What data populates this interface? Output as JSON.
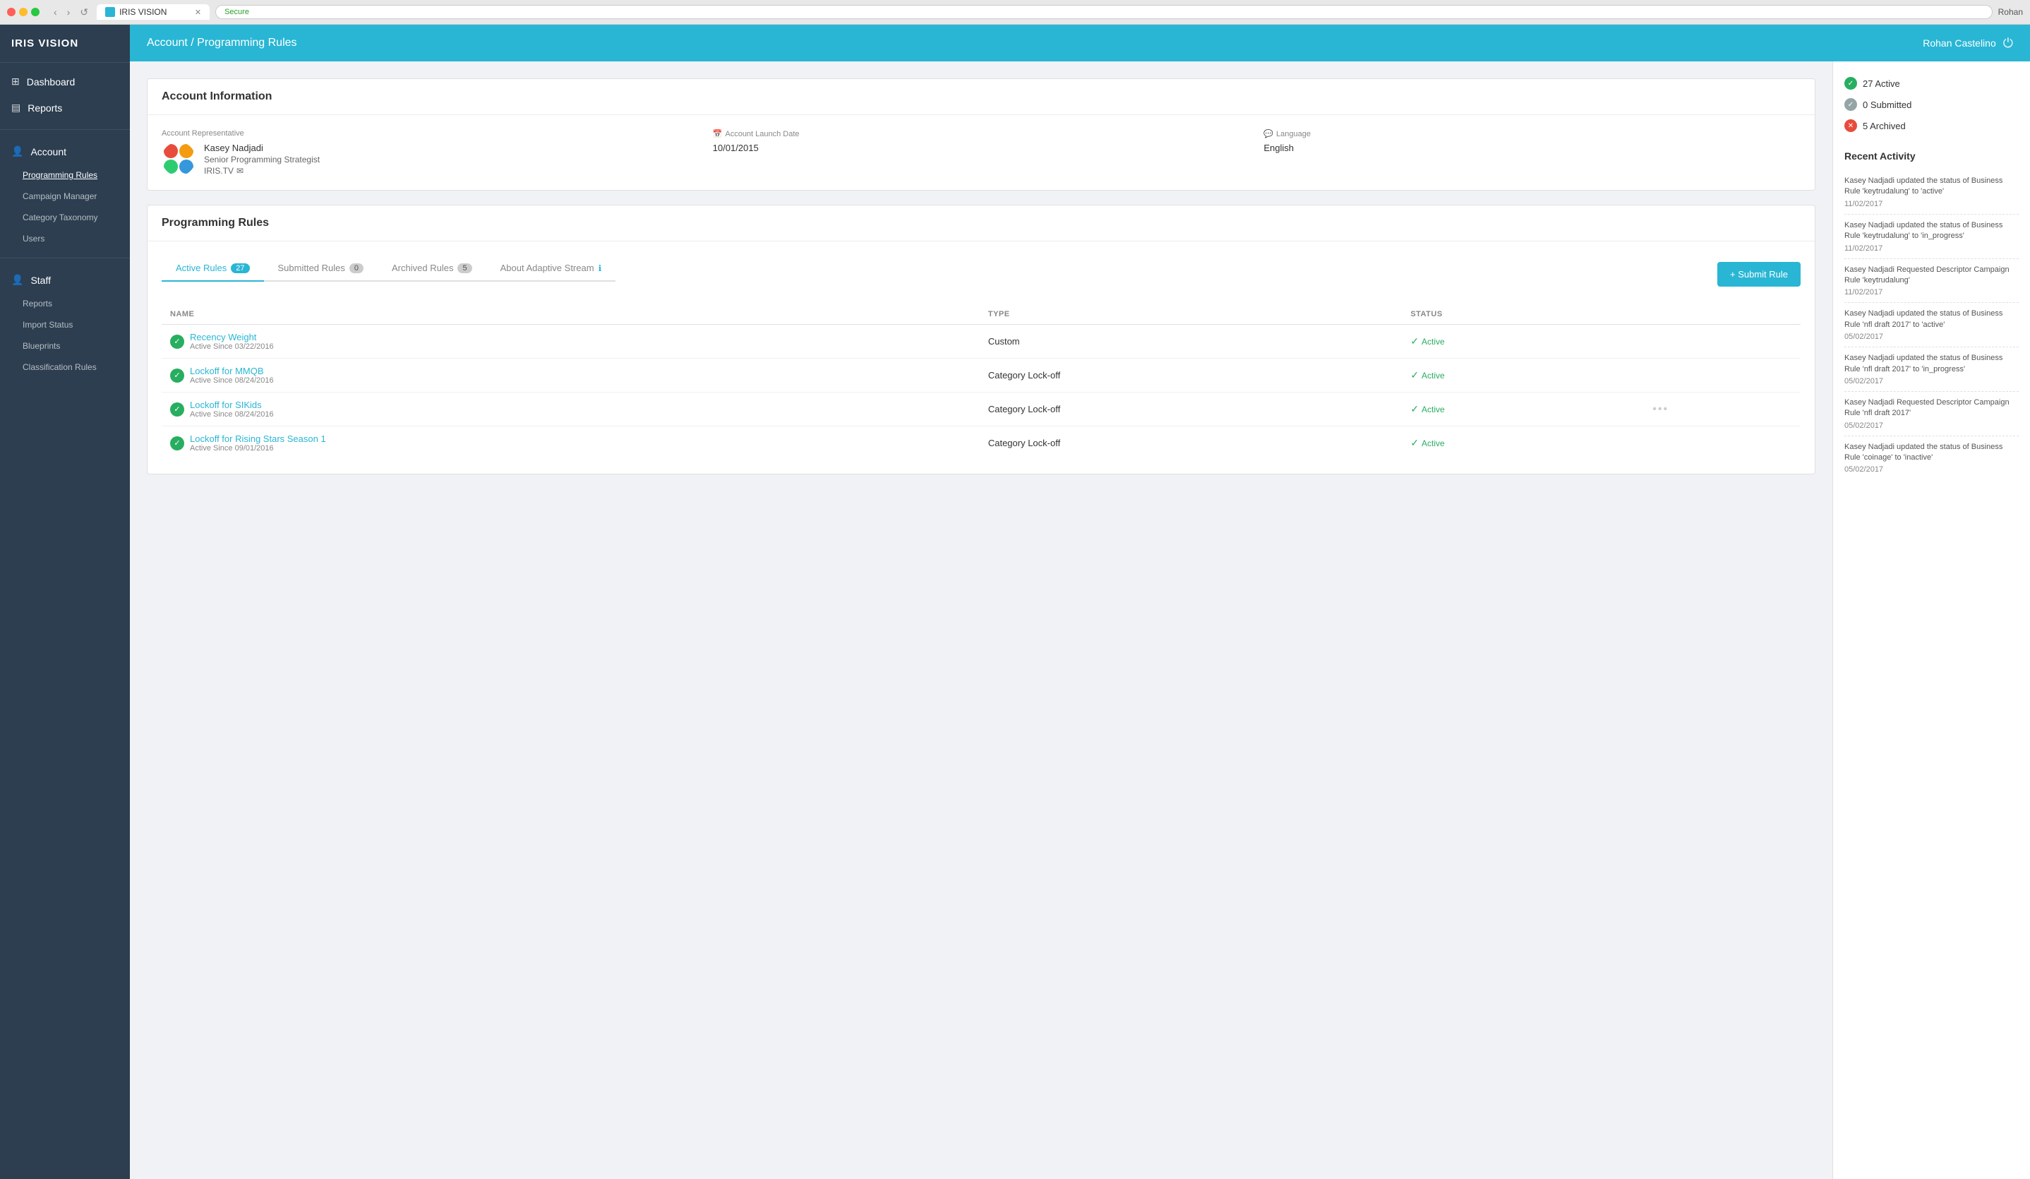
{
  "browser": {
    "tab_title": "IRIS VISION",
    "address": "Secure",
    "user": "Rohan"
  },
  "header": {
    "breadcrumb": "Account / Programming Rules",
    "user_name": "Rohan Castelino",
    "logout_label": "⏻"
  },
  "sidebar": {
    "logo": "IRIS VISION",
    "items": [
      {
        "id": "dashboard",
        "label": "Dashboard",
        "icon": "⊞",
        "type": "nav"
      },
      {
        "id": "reports",
        "label": "Reports",
        "icon": "▤",
        "type": "nav"
      },
      {
        "id": "account",
        "label": "Account",
        "icon": "👤",
        "type": "section"
      },
      {
        "id": "programming-rules",
        "label": "Programming Rules",
        "type": "sub",
        "active": true
      },
      {
        "id": "campaign-manager",
        "label": "Campaign Manager",
        "type": "sub"
      },
      {
        "id": "category-taxonomy",
        "label": "Category Taxonomy",
        "type": "sub"
      },
      {
        "id": "users",
        "label": "Users",
        "type": "sub"
      },
      {
        "id": "staff",
        "label": "Staff",
        "icon": "👤",
        "type": "section"
      },
      {
        "id": "staff-reports",
        "label": "Reports",
        "type": "sub"
      },
      {
        "id": "import-status",
        "label": "Import Status",
        "type": "sub"
      },
      {
        "id": "blueprints",
        "label": "Blueprints",
        "type": "sub"
      },
      {
        "id": "classification-rules",
        "label": "Classification Rules",
        "type": "sub"
      }
    ]
  },
  "account_info": {
    "section_title": "Account Information",
    "rep_label": "Account Representative",
    "rep_name": "Kasey Nadjadi",
    "rep_title": "Senior Programming Strategist",
    "rep_company": "IRIS.TV",
    "rep_email_icon": "✉",
    "launch_date_label": "Account Launch Date",
    "launch_date_icon": "📅",
    "launch_date_value": "10/01/2015",
    "language_label": "Language",
    "language_icon": "💬",
    "language_value": "English"
  },
  "programming_rules": {
    "section_title": "Programming Rules",
    "submit_btn": "+ Submit Rule",
    "tabs": [
      {
        "id": "active",
        "label": "Active Rules",
        "badge": "27",
        "badge_type": "primary"
      },
      {
        "id": "submitted",
        "label": "Submitted Rules",
        "badge": "0",
        "badge_type": "gray"
      },
      {
        "id": "archived",
        "label": "Archived Rules",
        "badge": "5",
        "badge_type": "gray"
      },
      {
        "id": "adaptive",
        "label": "About Adaptive Stream",
        "badge": "",
        "badge_type": "info"
      }
    ],
    "columns": [
      "NAME",
      "TYPE",
      "STATUS"
    ],
    "rules": [
      {
        "name": "Recency Weight",
        "since": "Active Since 03/22/2016",
        "type": "Custom",
        "status": "Active",
        "has_dots": false
      },
      {
        "name": "Lockoff for MMQB",
        "since": "Active Since 08/24/2016",
        "type": "Category Lock-off",
        "status": "Active",
        "has_dots": false
      },
      {
        "name": "Lockoff for SIKids",
        "since": "Active Since 08/24/2016",
        "type": "Category Lock-off",
        "status": "Active",
        "has_dots": true
      },
      {
        "name": "Lockoff for Rising Stars Season 1",
        "since": "Active Since 09/01/2016",
        "type": "Category Lock-off",
        "status": "Active",
        "has_dots": false
      }
    ]
  },
  "right_panel": {
    "stats": [
      {
        "label": "27 Active",
        "type": "green"
      },
      {
        "label": "0 Submitted",
        "type": "gray"
      },
      {
        "label": "5 Archived",
        "type": "red"
      }
    ],
    "recent_activity_title": "Recent Activity",
    "activities": [
      {
        "text": "Kasey Nadjadi updated the status of Business Rule 'keytrudalung' to 'active'",
        "date": "11/02/2017"
      },
      {
        "text": "Kasey Nadjadi updated the status of Business Rule 'keytrudalung' to 'in_progress'",
        "date": "11/02/2017"
      },
      {
        "text": "Kasey Nadjadi Requested Descriptor Campaign Rule 'keytrudalung'",
        "date": "11/02/2017"
      },
      {
        "text": "Kasey Nadjadi updated the status of Business Rule 'nfl draft 2017' to 'active'",
        "date": "05/02/2017"
      },
      {
        "text": "Kasey Nadjadi updated the status of Business Rule 'nfl draft 2017' to 'in_progress'",
        "date": "05/02/2017"
      },
      {
        "text": "Kasey Nadjadi Requested Descriptor Campaign Rule 'nfl draft 2017'",
        "date": "05/02/2017"
      },
      {
        "text": "Kasey Nadjadi updated the status of Business Rule 'coinage' to 'inactive'",
        "date": "05/02/2017"
      }
    ]
  }
}
